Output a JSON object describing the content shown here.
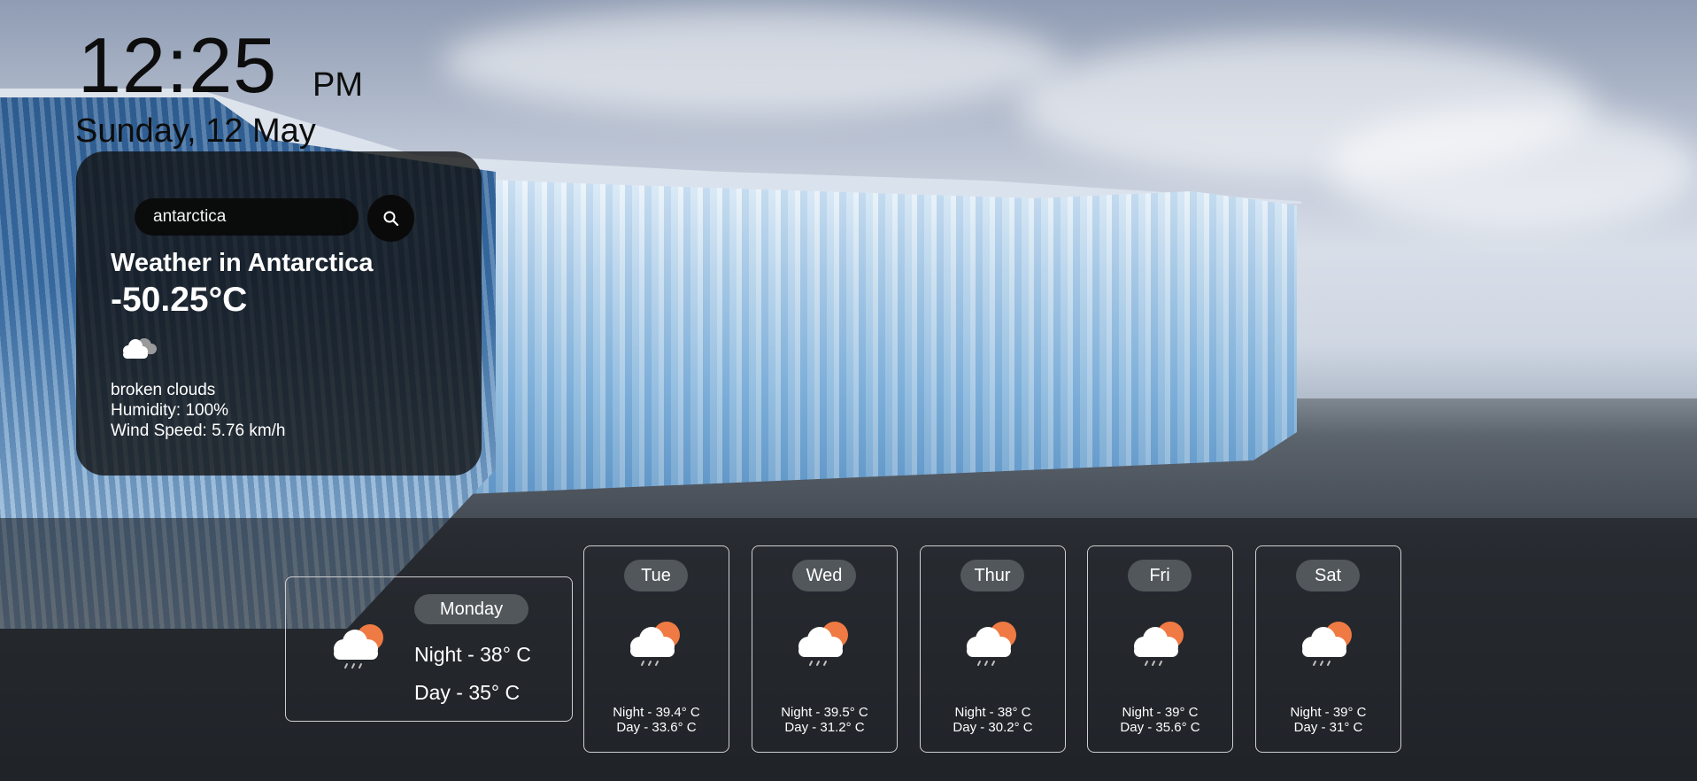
{
  "clock": {
    "time": "12:25",
    "ampm": "PM",
    "date": "Sunday, 12 May"
  },
  "search": {
    "value": "antarctica",
    "placeholder": ""
  },
  "current": {
    "title": "Weather in Antarctica",
    "temperature": "-50.25°C",
    "icon": "broken-clouds-icon",
    "description": "broken clouds",
    "humidity": "Humidity: 100%",
    "wind": "Wind Speed: 5.76 km/h"
  },
  "today": {
    "day": "Monday",
    "night": "Night - 38° C",
    "dayTemp": "Day - 35° C",
    "icon": "rain-sun-cloud-icon"
  },
  "forecast": [
    {
      "day": "Tue",
      "night": "Night - 39.4° C",
      "dayTemp": "Day - 33.6° C",
      "icon": "rain-sun-cloud-icon"
    },
    {
      "day": "Wed",
      "night": "Night - 39.5° C",
      "dayTemp": "Day - 31.2° C",
      "icon": "rain-sun-cloud-icon"
    },
    {
      "day": "Thur",
      "night": "Night - 38° C",
      "dayTemp": "Day - 30.2° C",
      "icon": "rain-sun-cloud-icon"
    },
    {
      "day": "Fri",
      "night": "Night - 39° C",
      "dayTemp": "Day - 35.6° C",
      "icon": "rain-sun-cloud-icon"
    },
    {
      "day": "Sat",
      "night": "Night - 39° C",
      "dayTemp": "Day - 31° C",
      "icon": "rain-sun-cloud-icon"
    }
  ],
  "colors": {
    "card": "#0f0f0f",
    "sun": "#f07a43",
    "cloud": "#ffffff"
  }
}
